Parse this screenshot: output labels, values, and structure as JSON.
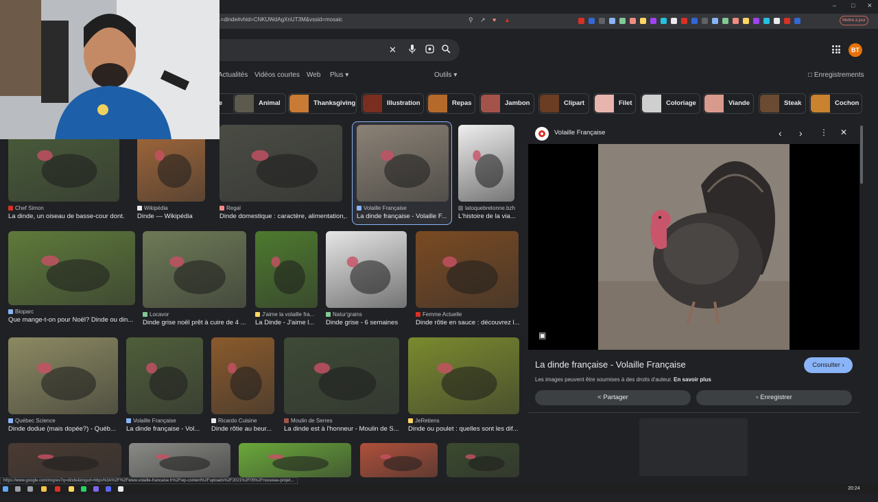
{
  "browser": {
    "url": "...=dinde#vhid=CNKUWdAgXnUT3M&vssid=mosaic",
    "update_button": "Mettre à jour",
    "status_url": "https://www.google.com/imgres?q=dinde&imgurl=https%3A%2F%2Fwww.volaille-francaise.fr%2Fwp-content%2Fuploads%2F2021%2F05%2Fnouveau-projet...",
    "clock": "20:24",
    "extension_colors": [
      "#d93025",
      "#3367d6",
      "#5f6368",
      "#8ab4f8",
      "#81c995",
      "#f28b82",
      "#fdd663",
      "#a142f4",
      "#24c1e0",
      "#e8eaed"
    ]
  },
  "header": {
    "avatar_initials": "BT",
    "icons": [
      "clear-icon",
      "mic-icon",
      "lens-icon",
      "search-icon",
      "apps-icon"
    ]
  },
  "tabs": {
    "items": [
      "Actualités",
      "Vidéos courtes",
      "Web",
      "Plus"
    ],
    "tools": "Outils",
    "saved": "Enregistrements"
  },
  "chips": [
    {
      "label": "...e",
      "color": "#8d7b64"
    },
    {
      "label": "Animal",
      "color": "#5c5a4c"
    },
    {
      "label": "Thanksgiving",
      "color": "#c97a34"
    },
    {
      "label": "Illustration",
      "color": "#7a2e1f"
    },
    {
      "label": "Repas",
      "color": "#b56a2c"
    },
    {
      "label": "Jambon",
      "color": "#a4534a"
    },
    {
      "label": "Clipart",
      "color": "#6b3d22"
    },
    {
      "label": "Filet",
      "color": "#e7b5ad"
    },
    {
      "label": "Coloriage",
      "color": "#cfcfcf"
    },
    {
      "label": "Viande",
      "color": "#d89a8d"
    },
    {
      "label": "Steak",
      "color": "#6a4a30"
    },
    {
      "label": "Cochon",
      "color": "#c9822d"
    }
  ],
  "results": [
    {
      "source": "Chef Simon",
      "title": "La dinde, un oiseau de basse-cour dont...",
      "color": "#4a5d3a",
      "fav": "#d93025"
    },
    {
      "source": "Wikipédia",
      "title": "Dinde — Wikipédia",
      "color": "#a5693a",
      "fav": "#e8eaed"
    },
    {
      "source": "Regal",
      "title": "Dinde domestique : caractère, alimentation,...",
      "color": "#4a4c44",
      "fav": "#f28b82"
    },
    {
      "source": "Volaille Française",
      "title": "La dinde française - Volaille F...",
      "color": "#8b8276",
      "fav": "#8ab4f8"
    },
    {
      "source": "latoquebretonne.bzh",
      "title": "L'histoire de la via...",
      "color": "#eeeeee",
      "fav": "#5f6368"
    },
    {
      "source": "Bioparc",
      "title": "Que mange-t-on pour Noël? Dinde ou din...",
      "color": "#5e7a3a",
      "fav": "#8ab4f8"
    },
    {
      "source": "Locavor",
      "title": "Dinde grise noël prêt à cuire de 4 ...",
      "color": "#6d7a56",
      "fav": "#81c995"
    },
    {
      "source": "J'aime la volaille fra...",
      "title": "La Dinde - J'aime l...",
      "color": "#4d7a2e",
      "fav": "#fdd663"
    },
    {
      "source": "Natur'grains",
      "title": "Dinde grise - 6 semaines",
      "color": "#e6e6e6",
      "fav": "#81c995"
    },
    {
      "source": "Femme Actuelle",
      "title": "Dinde rôtie en sauce : découvrez l...",
      "color": "#7a4a22",
      "fav": "#d93025"
    },
    {
      "source": "Québec Science",
      "title": "Dinde dodue (mais dopée?) - Québ...",
      "color": "#8c8a62",
      "fav": "#8ab4f8"
    },
    {
      "source": "Volaille Française",
      "title": "La dinde française - Vol...",
      "color": "#4f5e3a",
      "fav": "#8ab4f8"
    },
    {
      "source": "Ricardo Cuisine",
      "title": "Dinde rôtie au beur...",
      "color": "#8a5a2c",
      "fav": "#e8eaed"
    },
    {
      "source": "Moulin de Serres",
      "title": "La dinde est à l'honneur - Moulin de S...",
      "color": "#3e4a36",
      "fav": "#a4534a"
    },
    {
      "source": "JeRetiens",
      "title": "Dinde ou poulet : quelles sont les dif...",
      "color": "#7a8a2e",
      "fav": "#fdd663"
    },
    {
      "source": "",
      "title": "",
      "color": "#4a3a32",
      "fav": ""
    },
    {
      "source": "",
      "title": "",
      "color": "#8a8a86",
      "fav": ""
    },
    {
      "source": "",
      "title": "",
      "color": "#6aa83a",
      "fav": ""
    },
    {
      "source": "",
      "title": "",
      "color": "#b0503a",
      "fav": ""
    },
    {
      "source": "",
      "title": "",
      "color": "#3a4a2e",
      "fav": ""
    }
  ],
  "panel": {
    "site": "Volaille Française",
    "title": "La dinde française - Volaille Française",
    "rights_text": "Les images peuvent être soumises à des droits d'auteur.",
    "rights_link": "En savoir plus",
    "visit_button": "Consulter",
    "share_button": "Partager",
    "save_button": "Enregistrer"
  }
}
